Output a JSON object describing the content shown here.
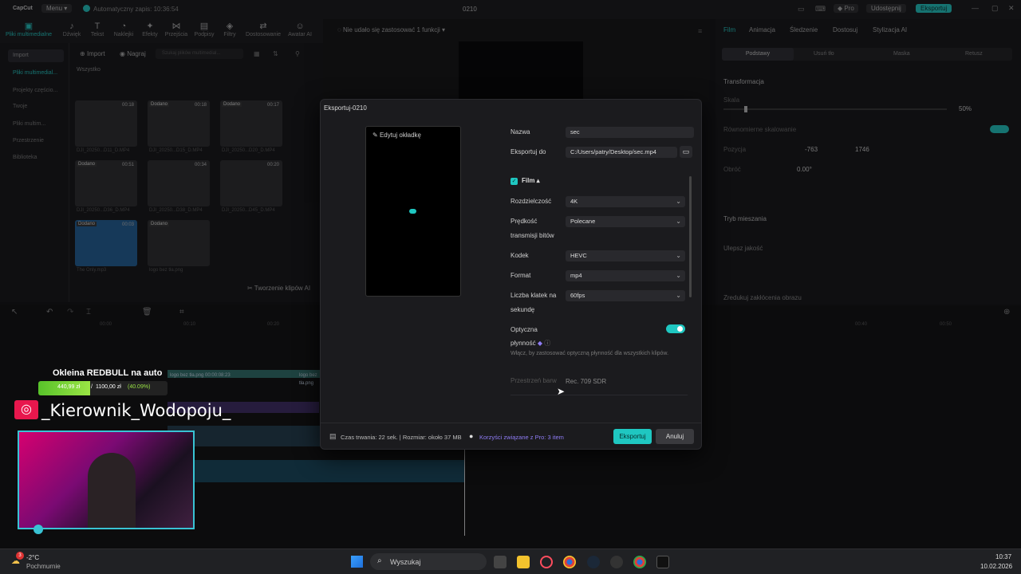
{
  "titlebar": {
    "app_name": "CapCut",
    "menu_label": "Menu",
    "autosave": "Automatyczny zapis: 10:36:54",
    "project_name": "0210",
    "pro_label": "Pro",
    "share_label": "Udostępnij",
    "export_label": "Eksportuj"
  },
  "toolbar": {
    "items": [
      "Pliki multimedialne",
      "Dźwięk",
      "Tekst",
      "Naklejki",
      "Efekty",
      "Przejścia",
      "Podpisy",
      "Filtry",
      "Dostosowanie",
      "Awatar AI"
    ]
  },
  "left_panel": {
    "nav": [
      "Import",
      "Pliki multimedial...",
      "Projekty częścio...",
      "Twoje",
      "Pliki multim...",
      "Przestrzenie",
      "Biblioteka"
    ],
    "import_btn": "Import",
    "record_btn": "Nagraj",
    "search_placeholder": "Szukaj plików multimedial...",
    "all_label": "Wszystko",
    "thumbs": [
      {
        "name": "DJI_20250...D11_D.MP4",
        "dur": "00:18",
        "tag": ""
      },
      {
        "name": "DJI_20250...D15_D.MP4",
        "dur": "00:18",
        "tag": "Dodano"
      },
      {
        "name": "DJI_20250...D20_D.MP4",
        "dur": "00:17",
        "tag": "Dodano"
      },
      {
        "name": "DJI_20250...D36_D.MP4",
        "dur": "00:51",
        "tag": "Dodano"
      },
      {
        "name": "DJI_20250...D38_D.MP4",
        "dur": "00:34",
        "tag": ""
      },
      {
        "name": "DJI_20250...D45_D.MP4",
        "dur": "00:20",
        "tag": ""
      },
      {
        "name": "The Only.mp3",
        "dur": "00:03",
        "tag": "Dodano"
      },
      {
        "name": "logo bez tła.png",
        "dur": "",
        "tag": "Dodano"
      }
    ],
    "clips_btn": "Tworzenie klipów AI"
  },
  "preview": {
    "notice": "Nie udało się zastosować 1 funkcji"
  },
  "right_panel": {
    "tabs": [
      "Film",
      "Animacja",
      "Śledzenie",
      "Dostosuj",
      "Stylizacja AI"
    ],
    "subtabs": [
      "Podstawy",
      "Usuń tło",
      "Maska",
      "Retusz"
    ],
    "transform": "Transformacja",
    "scale": "Skala",
    "scale_val": "50%",
    "uniform": "Równomierne skalowanie",
    "position": "Pozycja",
    "pos_x": "-763",
    "pos_y": "1746",
    "rotate": "Obróć",
    "rotate_val": "0.00°",
    "blend": "Tryb mieszania",
    "enhance": "Ulepsz jakość",
    "denoise": "Zredukuj zakłócenia obrazu"
  },
  "dialog": {
    "title": "Eksportuj-0210",
    "edit_cover": "Edytuj okładkę",
    "name_label": "Nazwa",
    "name_value": "sec",
    "export_to_label": "Eksportuj do",
    "export_to_value": "C:/Users/patry/Desktop/sec.mp4",
    "film_label": "Film",
    "resolution_label": "Rozdzielczość",
    "resolution_value": "4K",
    "bitrate_label_1": "Prędkość",
    "bitrate_label_2": "transmisji bitów",
    "bitrate_value": "Polecane",
    "codec_label": "Kodek",
    "codec_value": "HEVC",
    "format_label": "Format",
    "format_value": "mp4",
    "fps_label_1": "Liczba klatek na",
    "fps_label_2": "sekundę",
    "fps_value": "60fps",
    "optical_label_1": "Optyczna",
    "optical_label_2": "płynność",
    "optical_desc": "Włącz, by zastosować optyczną płynność dla wszystkich klipów.",
    "color_label": "Przestrzeń barw",
    "color_value": "Rec. 709 SDR",
    "info": "Czas trwania: 22 sek. | Rozmiar: około 37 MB",
    "pro_info": "Korzyści związane z Pro: 3 item",
    "export_btn": "Eksportuj",
    "cancel_btn": "Anuluj"
  },
  "overlay": {
    "headline": "Okleina REDBULL na auto",
    "price_old": "440,99 zł",
    "price_new": "1100,00 zł",
    "percent": "(40.09%)",
    "handle": "_Kierownik_Wodopoju_"
  },
  "timeline": {
    "ticks": [
      "00:00",
      "00:10",
      "00:20",
      "00:40",
      "00:50"
    ],
    "track_labels": [
      "logo bez tła.png 00:00:08:23",
      "logo bez tła.png"
    ]
  },
  "taskbar": {
    "temp": "-2°C",
    "weather": "Pochmurnie",
    "search": "Wyszukaj",
    "time": "10:37",
    "date": "10.02.2026",
    "badge": "3"
  },
  "colors": {
    "accent": "#1fc7c1",
    "pro": "#8f7cf5",
    "bg": "#0d0d0f"
  }
}
